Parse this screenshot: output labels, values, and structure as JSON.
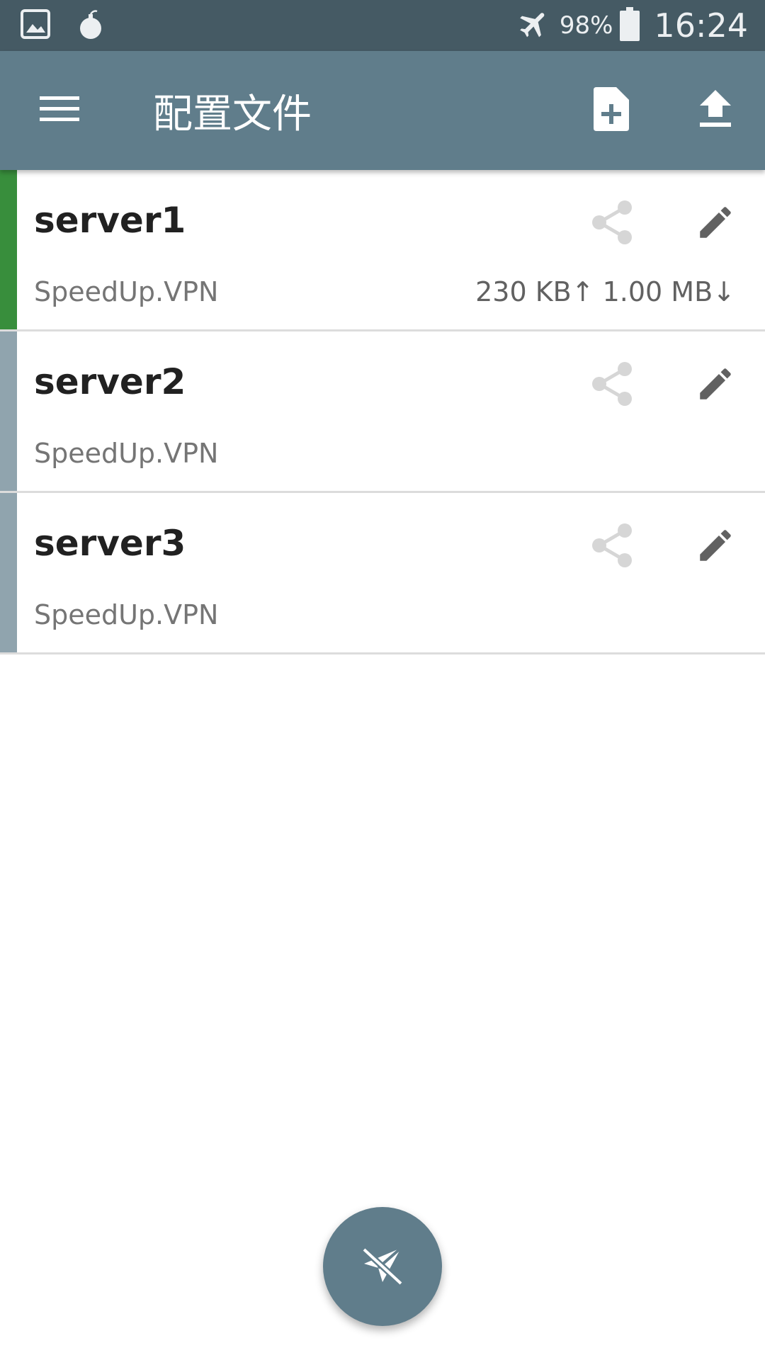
{
  "status_bar": {
    "battery_percent": "98%",
    "time": "16:24",
    "icons": [
      "image-icon",
      "bomb-icon",
      "airplane-mode-icon",
      "battery-icon"
    ]
  },
  "app_bar": {
    "title": "配置文件",
    "icons": {
      "menu": "menu-icon",
      "add": "add-file-icon",
      "import": "upload-icon"
    }
  },
  "profiles": [
    {
      "name": "server1",
      "host": "SpeedUp.VPN",
      "traffic": "230 KB↑ 1.00 MB↓",
      "active": true
    },
    {
      "name": "server2",
      "host": "SpeedUp.VPN",
      "traffic": "",
      "active": false
    },
    {
      "name": "server3",
      "host": "SpeedUp.VPN",
      "traffic": "",
      "active": false
    }
  ],
  "fab": {
    "icon": "plane-disconnected-icon"
  },
  "colors": {
    "status_bar": "#455a64",
    "app_bar": "#607d8b",
    "active_indicator": "#388e3c",
    "inactive_indicator": "#90a4ae",
    "fab": "#607d8b"
  }
}
